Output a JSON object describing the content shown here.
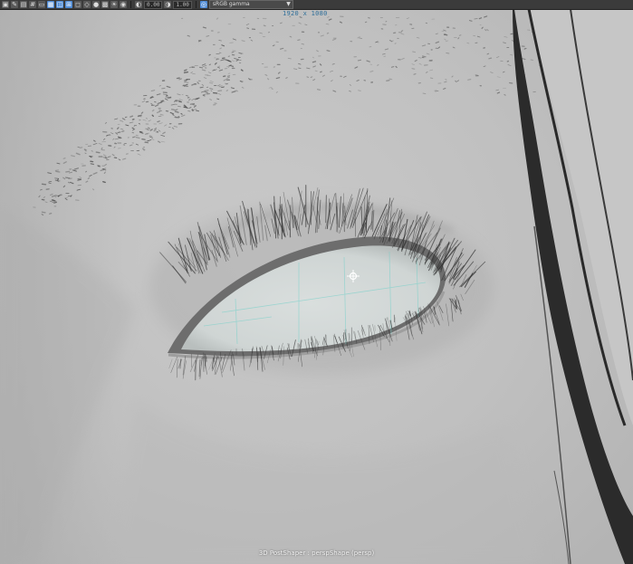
{
  "toolbar": {
    "buttons": [
      {
        "icon": "select-camera-icon"
      },
      {
        "icon": "bookmark-icon"
      },
      {
        "icon": "image-plane-icon"
      },
      {
        "icon": "grid-icon"
      },
      {
        "icon": "film-gate-icon"
      },
      {
        "icon": "resolution-gate-icon",
        "active": true
      },
      {
        "icon": "gate-mask-icon",
        "active": true
      },
      {
        "icon": "field-chart-icon",
        "active": true
      },
      {
        "icon": "safe-action-icon"
      },
      {
        "icon": "wireframe-icon"
      },
      {
        "icon": "smooth-shade-icon"
      },
      {
        "icon": "textured-icon"
      },
      {
        "icon": "lighting-icon"
      },
      {
        "icon": "isolate-select-icon"
      }
    ],
    "exposure_value": "0.00",
    "gamma_value": "1.00",
    "color_space": "sRGB gamma"
  },
  "overlay": {
    "resolution_gate": "1920 x 1080",
    "camera_label": "3D PostShaper : perspShape (persp)"
  },
  "colors": {
    "background": "#bdbdbd",
    "skin": "#c3c3c3",
    "eye_white": "#d6dcdc",
    "eye_wire": "#6fd0c8",
    "lash_dark": "#333333",
    "hair_strap": "#2a2a2a"
  }
}
